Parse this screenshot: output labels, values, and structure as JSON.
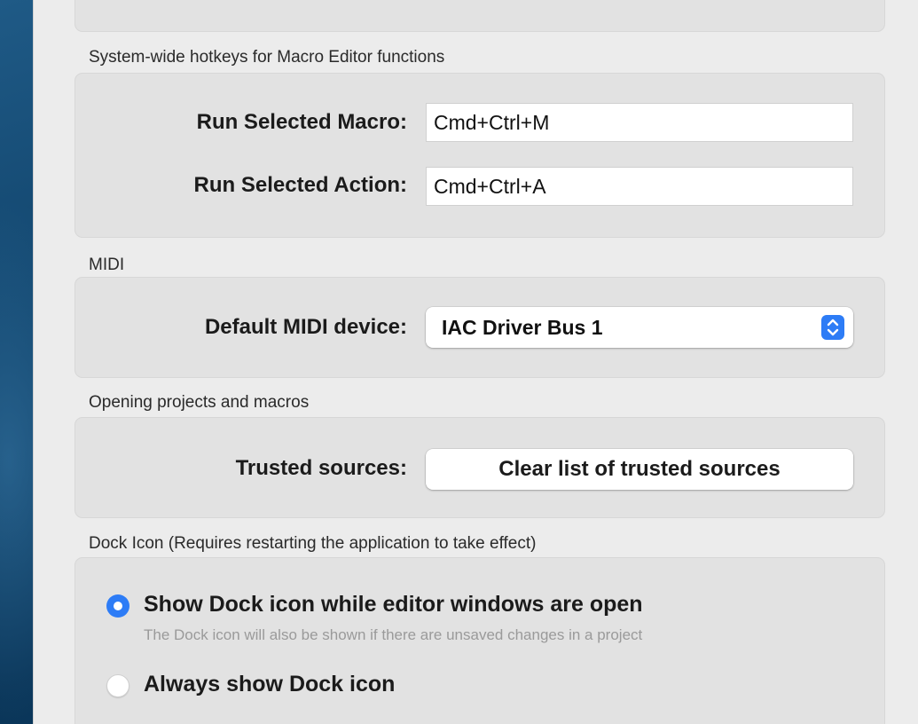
{
  "hotkeys_section": {
    "title": "System-wide hotkeys for Macro Editor functions",
    "run_selected_macro": {
      "label": "Run Selected Macro:",
      "value": "Cmd+Ctrl+M"
    },
    "run_selected_action": {
      "label": "Run Selected Action:",
      "value": "Cmd+Ctrl+A"
    }
  },
  "midi_section": {
    "title": "MIDI",
    "default_device_label": "Default MIDI device:",
    "default_device_value": "IAC Driver Bus 1"
  },
  "opening_section": {
    "title": "Opening projects and macros",
    "trusted_sources_label": "Trusted sources:",
    "clear_button_label": "Clear list of trusted sources"
  },
  "dock_section": {
    "title": "Dock Icon (Requires restarting the application to take effect)",
    "options": [
      {
        "label": "Show Dock icon while editor windows are open",
        "selected": true,
        "hint": "The Dock icon will also be shown if there are unsaved changes in a project"
      },
      {
        "label": "Always show Dock icon",
        "selected": false
      }
    ]
  },
  "colors": {
    "accent": "#2d7cf6",
    "window_bg": "#ececec",
    "group_bg": "#e2e2e2"
  }
}
